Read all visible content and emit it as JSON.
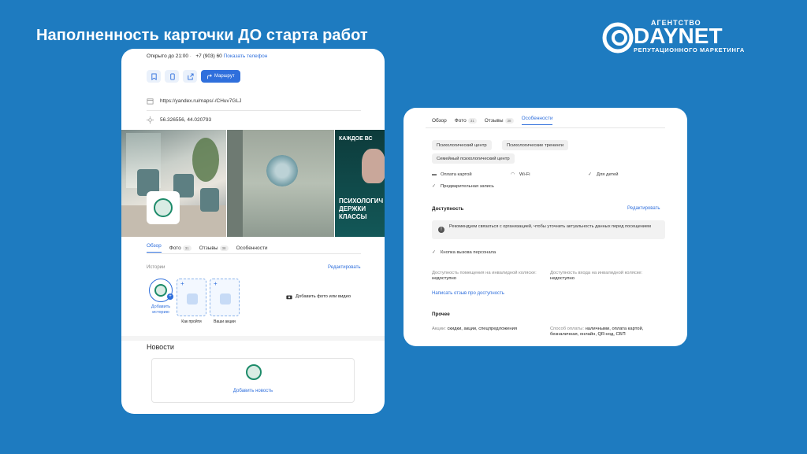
{
  "slide": {
    "title": "Наполненность карточки ДО старта работ"
  },
  "logo": {
    "agency": "АГЕНТСТВО",
    "brand": "DAYNET",
    "tagline": "РЕПУТАЦИОННОГО МАРКЕТИНГА"
  },
  "left_card": {
    "hours": "Открыто до 21:00",
    "phone": "+7 (903) 60",
    "show_phone": "Показать телефон",
    "route_label": "Маршрут",
    "url": "https://yandex.ru/maps/-/CHuv7GLJ",
    "coords": "56.326556, 44.020793",
    "photo_banner_top": "КАЖДОЕ ВС",
    "photo_banner_mid": "ПСИХОЛОГИЧ ДЕРЖКИ КЛАССЫ",
    "add_photo": "Добавить фото или видео",
    "photo_caption": "психолог",
    "tabs": [
      {
        "label": "Обзор",
        "count": ""
      },
      {
        "label": "Фото",
        "count": "31"
      },
      {
        "label": "Отзывы",
        "count": "38"
      },
      {
        "label": "Особенности",
        "count": ""
      }
    ],
    "stories_label": "Истории",
    "edit": "Редактировать",
    "add_story": "Добавить историю",
    "story_boxes": [
      "Как пройти",
      "Ваши акции"
    ],
    "news_title": "Новости",
    "add_news": "Добавить новость"
  },
  "right_card": {
    "tabs": [
      {
        "label": "Обзор",
        "count": ""
      },
      {
        "label": "Фото",
        "count": "31"
      },
      {
        "label": "Отзывы",
        "count": "38"
      },
      {
        "label": "Особенности",
        "count": ""
      }
    ],
    "chips": [
      "Психологический центр",
      "Психологические тренинги",
      "Семейный психологический центр"
    ],
    "features": [
      "Оплата картой",
      "Wi-Fi",
      "Для детей",
      "Предварительная запись"
    ],
    "accessibility_title": "Доступность",
    "edit": "Редактировать",
    "notice": "Рекомендуем связаться с организацией, чтобы уточнить актуальность данных перед посещением",
    "staff_button": "Кнопка вызова персонала",
    "access_room_label": "Доступность помещения на инвалидной коляске:",
    "access_room_value": "недоступно",
    "access_entry_label": "Доступность входа на инвалидной коляске:",
    "access_entry_value": "недоступно",
    "review_link": "Написать отзыв про доступность",
    "other_title": "Прочее",
    "promos_label": "Акции:",
    "promos_value": "скидки, акции, спецпредложения",
    "payment_label": "Способ оплаты:",
    "payment_value": "наличными, оплата картой, безналичная, онлайн, QR-код, СБП"
  },
  "colors": {
    "background": "#1e7bc0",
    "accent": "#2f6fdc"
  }
}
